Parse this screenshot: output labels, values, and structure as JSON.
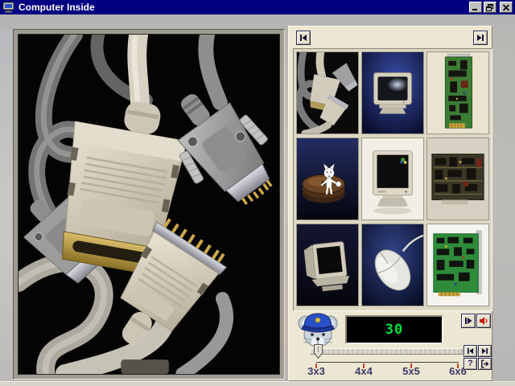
{
  "window": {
    "title": "Computer Inside"
  },
  "filmstrip": {
    "thumbnails": [
      {
        "icon": "cables-photo"
      },
      {
        "icon": "crt-monitor-blue"
      },
      {
        "icon": "green-circuit-board"
      },
      {
        "icon": "hard-disk-platters-with-cat"
      },
      {
        "icon": "crt-monitor-white"
      },
      {
        "icon": "dark-circuit-board"
      },
      {
        "icon": "crt-monitor-angled"
      },
      {
        "icon": "computer-mouse"
      },
      {
        "icon": "green-sound-card"
      }
    ]
  },
  "controls": {
    "counter_value": "30",
    "help_label": "?",
    "sizes": [
      "3x3",
      "4x4",
      "5x5",
      "6x6"
    ]
  },
  "icons": {
    "app": "computer-icon",
    "nav_first": "skip-to-first-icon",
    "nav_last": "skip-to-last-icon",
    "play": "step-play-icon",
    "sound": "speaker-icon",
    "exit": "exit-door-icon",
    "mascot": "mouse-with-cap-icon"
  },
  "colors": {
    "titlebar": "#000080",
    "panel": "#ece7d3",
    "counter_text": "#00e038",
    "tick": "#c8402a",
    "speaker_icon": "#cc1111"
  }
}
